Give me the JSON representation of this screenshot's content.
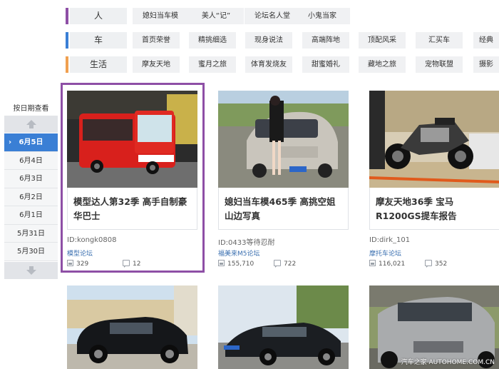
{
  "categories": [
    {
      "label": "人",
      "color": "#8e4fa6",
      "tags": [
        "媳妇当车模",
        "美人“记”",
        "论坛名人堂",
        "小鬼当家"
      ]
    },
    {
      "label": "车",
      "color": "#3a7fd5",
      "tags": [
        "首页荣誉",
        "精挑细选",
        "现身说法",
        "高端阵地",
        "顶配风采",
        "汇买车",
        "经典"
      ]
    },
    {
      "label": "生活",
      "color": "#f0a050",
      "tags": [
        "摩友天地",
        "蜜月之旅",
        "体育发烧友",
        "甜蜜婚礼",
        "藏地之旅",
        "宠物联盟",
        "摄影"
      ]
    }
  ],
  "date_nav": {
    "title": "按日期查看",
    "active_caret": "›",
    "dates": [
      "6月5日",
      "6月4日",
      "6月3日",
      "6月2日",
      "6月1日",
      "5月31日",
      "5月30日"
    ],
    "active_index": 0
  },
  "cards": [
    {
      "caption": "模型达人第32季 高手自制豪华巴士",
      "id": "ID:kongk0808",
      "forum": "模型论坛",
      "views": "329",
      "replies": "12",
      "image": "red-bus-photo"
    },
    {
      "caption": "媳妇当车模465季 高挑空姐山边写真",
      "id": "ID:0433等待忍耐",
      "forum": "福美来M5论坛",
      "views": "155,710",
      "replies": "722",
      "image": "model-with-car-photo",
      "plate": "苏D2468"
    },
    {
      "caption": "摩友天地36季 宝马R1200GS提车报告",
      "id": "ID:dirk_101",
      "forum": "摩托车论坛",
      "views": "116,021",
      "replies": "352",
      "image": "bmw-motorcycle-photo"
    }
  ],
  "bottom_thumbs": [
    "black-suv-photo",
    "black-sedan-photo",
    "silver-suv-photo"
  ],
  "watermark": "汽车之家 AUTOHOME.COM.CN"
}
